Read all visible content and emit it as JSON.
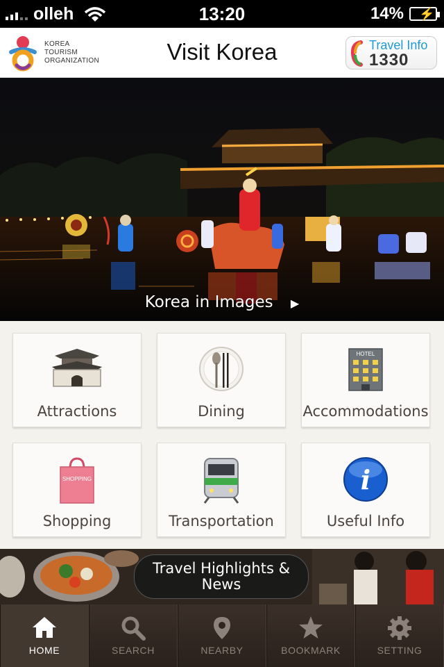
{
  "status_bar": {
    "carrier": "olleh",
    "time": "13:20",
    "battery": "14%"
  },
  "header": {
    "logo_text_lines": [
      "KOREA",
      "TOURISM",
      "ORGANIZATION"
    ],
    "title": "Visit Korea",
    "travel_info_label": "Travel Info",
    "travel_info_number": "1330"
  },
  "hero": {
    "caption": "Korea in Images",
    "caption_arrow": "▶"
  },
  "tiles": [
    {
      "label": "Attractions",
      "icon": "palace-gate-icon"
    },
    {
      "label": "Dining",
      "icon": "spoon-chopsticks-icon"
    },
    {
      "label": "Accommodations",
      "icon": "hotel-building-icon"
    },
    {
      "label": "Shopping",
      "icon": "shopping-bag-icon"
    },
    {
      "label": "Transportation",
      "icon": "train-icon"
    },
    {
      "label": "Useful Info",
      "icon": "info-icon"
    }
  ],
  "hotel_sign": "HOTEL",
  "shopping_bag_text": "SHOPPING",
  "banner": {
    "line1": "Travel Highlights &",
    "line2": "News"
  },
  "tabbar": [
    {
      "label": "HOME",
      "icon": "home-icon",
      "active": true
    },
    {
      "label": "SEARCH",
      "icon": "search-icon",
      "active": false
    },
    {
      "label": "NEARBY",
      "icon": "location-pin-icon",
      "active": false
    },
    {
      "label": "BOOKMARK",
      "icon": "star-icon",
      "active": false
    },
    {
      "label": "SETTING",
      "icon": "gear-icon",
      "active": false
    }
  ],
  "colors": {
    "tabbar_bg": "#2a211c",
    "accent_blue": "#1d9ad6",
    "tile_text": "#4a4440"
  }
}
